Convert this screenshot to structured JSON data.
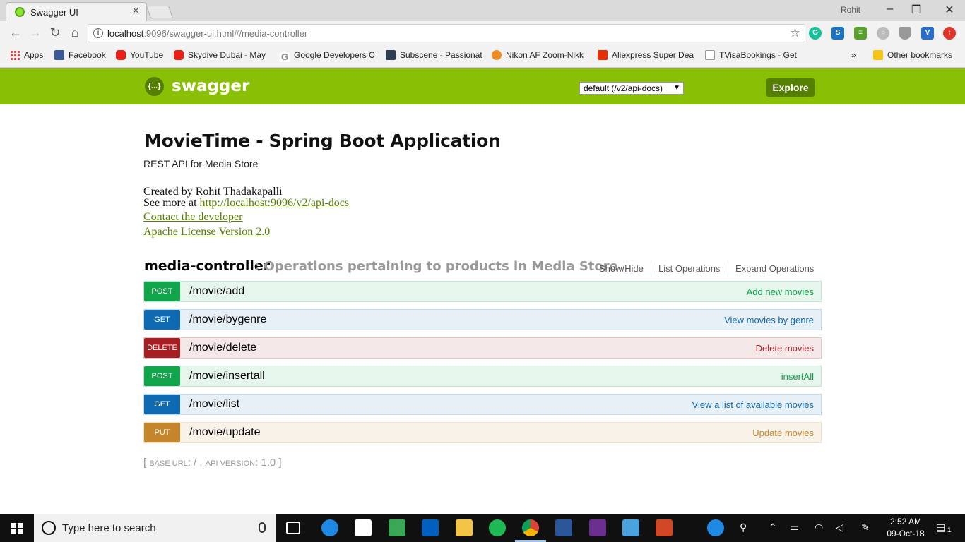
{
  "browser": {
    "tab_title": "Swagger UI",
    "user_name": "Rohit",
    "url_host": "localhost",
    "url_rest": ":9096/swagger-ui.html#/media-controller",
    "bookmarks": [
      {
        "label": "Apps",
        "icon": "apps-icon"
      },
      {
        "label": "Facebook",
        "icon": "facebook-icon",
        "color": "#3b5998"
      },
      {
        "label": "YouTube",
        "icon": "youtube-icon",
        "color": "#e62117"
      },
      {
        "label": "Skydive Dubai - May",
        "icon": "youtube-icon",
        "color": "#e62117"
      },
      {
        "label": "Google Developers C",
        "icon": "google-icon",
        "color": "#888888"
      },
      {
        "label": "Subscene - Passionat",
        "icon": "subscene-icon",
        "color": "#2d3e50"
      },
      {
        "label": "Nikon AF Zoom-Nikk",
        "icon": "nikon-icon",
        "color": "#f08a24"
      },
      {
        "label": "Aliexpress Super Dea",
        "icon": "aliexpress-icon",
        "color": "#e62e04"
      },
      {
        "label": "TVisaBookings - Get I",
        "icon": "page-icon",
        "color": "#bbbbbb"
      },
      {
        "label": "»",
        "icon": "overflow-icon"
      },
      {
        "label": "Other bookmarks",
        "icon": "folder-icon",
        "color": "#f5c518"
      }
    ]
  },
  "swagger": {
    "logo_text": "swagger",
    "logo_icon": "{...}",
    "spec_select": "default (/v2/api-docs)",
    "explore_label": "Explore"
  },
  "info": {
    "title": "MovieTime - Spring Boot Application",
    "description": "REST API for Media Store",
    "created_by": "Created by Rohit Thadakapalli",
    "see_more_prefix": "See more at ",
    "see_more_link": "http://localhost:9096/v2/api-docs",
    "contact": "Contact the developer",
    "license": "Apache License Version 2.0"
  },
  "resource": {
    "name": "media-controller",
    "description": ": Operations pertaining to products in Media Store",
    "actions": [
      "Show/Hide",
      "List Operations",
      "Expand Operations"
    ],
    "operations": [
      {
        "method": "POST",
        "path": "/movie/add",
        "summary": "Add new movies"
      },
      {
        "method": "GET",
        "path": "/movie/bygenre",
        "summary": "View movies by genre"
      },
      {
        "method": "DELETE",
        "path": "/movie/delete",
        "summary": "Delete movies"
      },
      {
        "method": "POST",
        "path": "/movie/insertall",
        "summary": "insertAll"
      },
      {
        "method": "GET",
        "path": "/movie/list",
        "summary": "View a list of available movies"
      },
      {
        "method": "PUT",
        "path": "/movie/update",
        "summary": "Update movies"
      }
    ]
  },
  "footer": {
    "open": "[ ",
    "base_url_label": "base url",
    "base_url_value": ": / , ",
    "api_version_label": "api version",
    "api_version_value": ": 1.0 ]"
  },
  "taskbar": {
    "search_placeholder": "Type here to search",
    "time": "2:52 AM",
    "date": "09-Oct-18",
    "notification_count": "1"
  },
  "colors": {
    "swagger_green": "#89bf04",
    "swagger_dark_green": "#547f00",
    "post": "#10a54a",
    "get": "#0f6ab4",
    "delete": "#a41e22",
    "put": "#c5862b"
  }
}
